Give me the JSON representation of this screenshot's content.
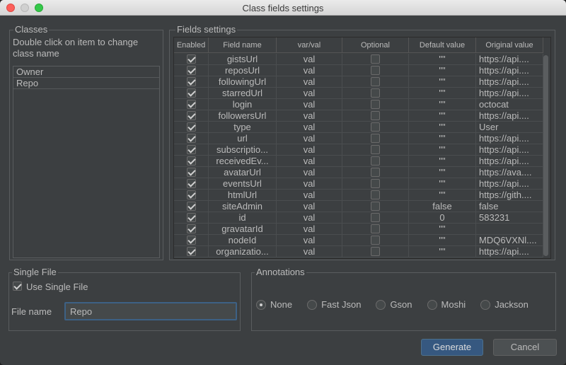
{
  "window": {
    "title": "Class fields settings"
  },
  "classes": {
    "group_label": "Classes",
    "hint": "Double click on item to change class name",
    "items": [
      "Owner",
      "Repo"
    ]
  },
  "fields": {
    "group_label": "Fields settings",
    "columns": [
      "Enabled",
      "Field name",
      "var/val",
      "Optional",
      "Default value",
      "Original value"
    ],
    "rows": [
      {
        "enabled": true,
        "name": "gistsUrl",
        "varval": "val",
        "optional": false,
        "default": "\"\"",
        "original": "https://api...."
      },
      {
        "enabled": true,
        "name": "reposUrl",
        "varval": "val",
        "optional": false,
        "default": "\"\"",
        "original": "https://api...."
      },
      {
        "enabled": true,
        "name": "followingUrl",
        "varval": "val",
        "optional": false,
        "default": "\"\"",
        "original": "https://api...."
      },
      {
        "enabled": true,
        "name": "starredUrl",
        "varval": "val",
        "optional": false,
        "default": "\"\"",
        "original": "https://api...."
      },
      {
        "enabled": true,
        "name": "login",
        "varval": "val",
        "optional": false,
        "default": "\"\"",
        "original": "octocat"
      },
      {
        "enabled": true,
        "name": "followersUrl",
        "varval": "val",
        "optional": false,
        "default": "\"\"",
        "original": "https://api...."
      },
      {
        "enabled": true,
        "name": "type",
        "varval": "val",
        "optional": false,
        "default": "\"\"",
        "original": "User"
      },
      {
        "enabled": true,
        "name": "url",
        "varval": "val",
        "optional": false,
        "default": "\"\"",
        "original": "https://api...."
      },
      {
        "enabled": true,
        "name": "subscriptio...",
        "varval": "val",
        "optional": false,
        "default": "\"\"",
        "original": "https://api...."
      },
      {
        "enabled": true,
        "name": "receivedEv...",
        "varval": "val",
        "optional": false,
        "default": "\"\"",
        "original": "https://api...."
      },
      {
        "enabled": true,
        "name": "avatarUrl",
        "varval": "val",
        "optional": false,
        "default": "\"\"",
        "original": "https://ava...."
      },
      {
        "enabled": true,
        "name": "eventsUrl",
        "varval": "val",
        "optional": false,
        "default": "\"\"",
        "original": "https://api...."
      },
      {
        "enabled": true,
        "name": "htmlUrl",
        "varval": "val",
        "optional": false,
        "default": "\"\"",
        "original": "https://gith...."
      },
      {
        "enabled": true,
        "name": "siteAdmin",
        "varval": "val",
        "optional": false,
        "default": "false",
        "original": "false"
      },
      {
        "enabled": true,
        "name": "id",
        "varval": "val",
        "optional": false,
        "default": "0",
        "original": "583231"
      },
      {
        "enabled": true,
        "name": "gravatarId",
        "varval": "val",
        "optional": false,
        "default": "\"\"",
        "original": ""
      },
      {
        "enabled": true,
        "name": "nodeId",
        "varval": "val",
        "optional": false,
        "default": "\"\"",
        "original": "MDQ6VXNl...."
      },
      {
        "enabled": true,
        "name": "organizatio...",
        "varval": "val",
        "optional": false,
        "default": "\"\"",
        "original": "https://api...."
      }
    ]
  },
  "single_file": {
    "group_label": "Single File",
    "checkbox_label": "Use Single File",
    "checked": true,
    "file_name_label": "File name",
    "file_name_value": "Repo"
  },
  "annotations": {
    "group_label": "Annotations",
    "options": [
      "None",
      "Fast Json",
      "Gson",
      "Moshi",
      "Jackson"
    ],
    "selected": "None"
  },
  "buttons": {
    "generate": "Generate",
    "cancel": "Cancel"
  },
  "colors": {
    "accent": "#365880",
    "background": "#3c3f41",
    "focus": "#3d6185"
  }
}
